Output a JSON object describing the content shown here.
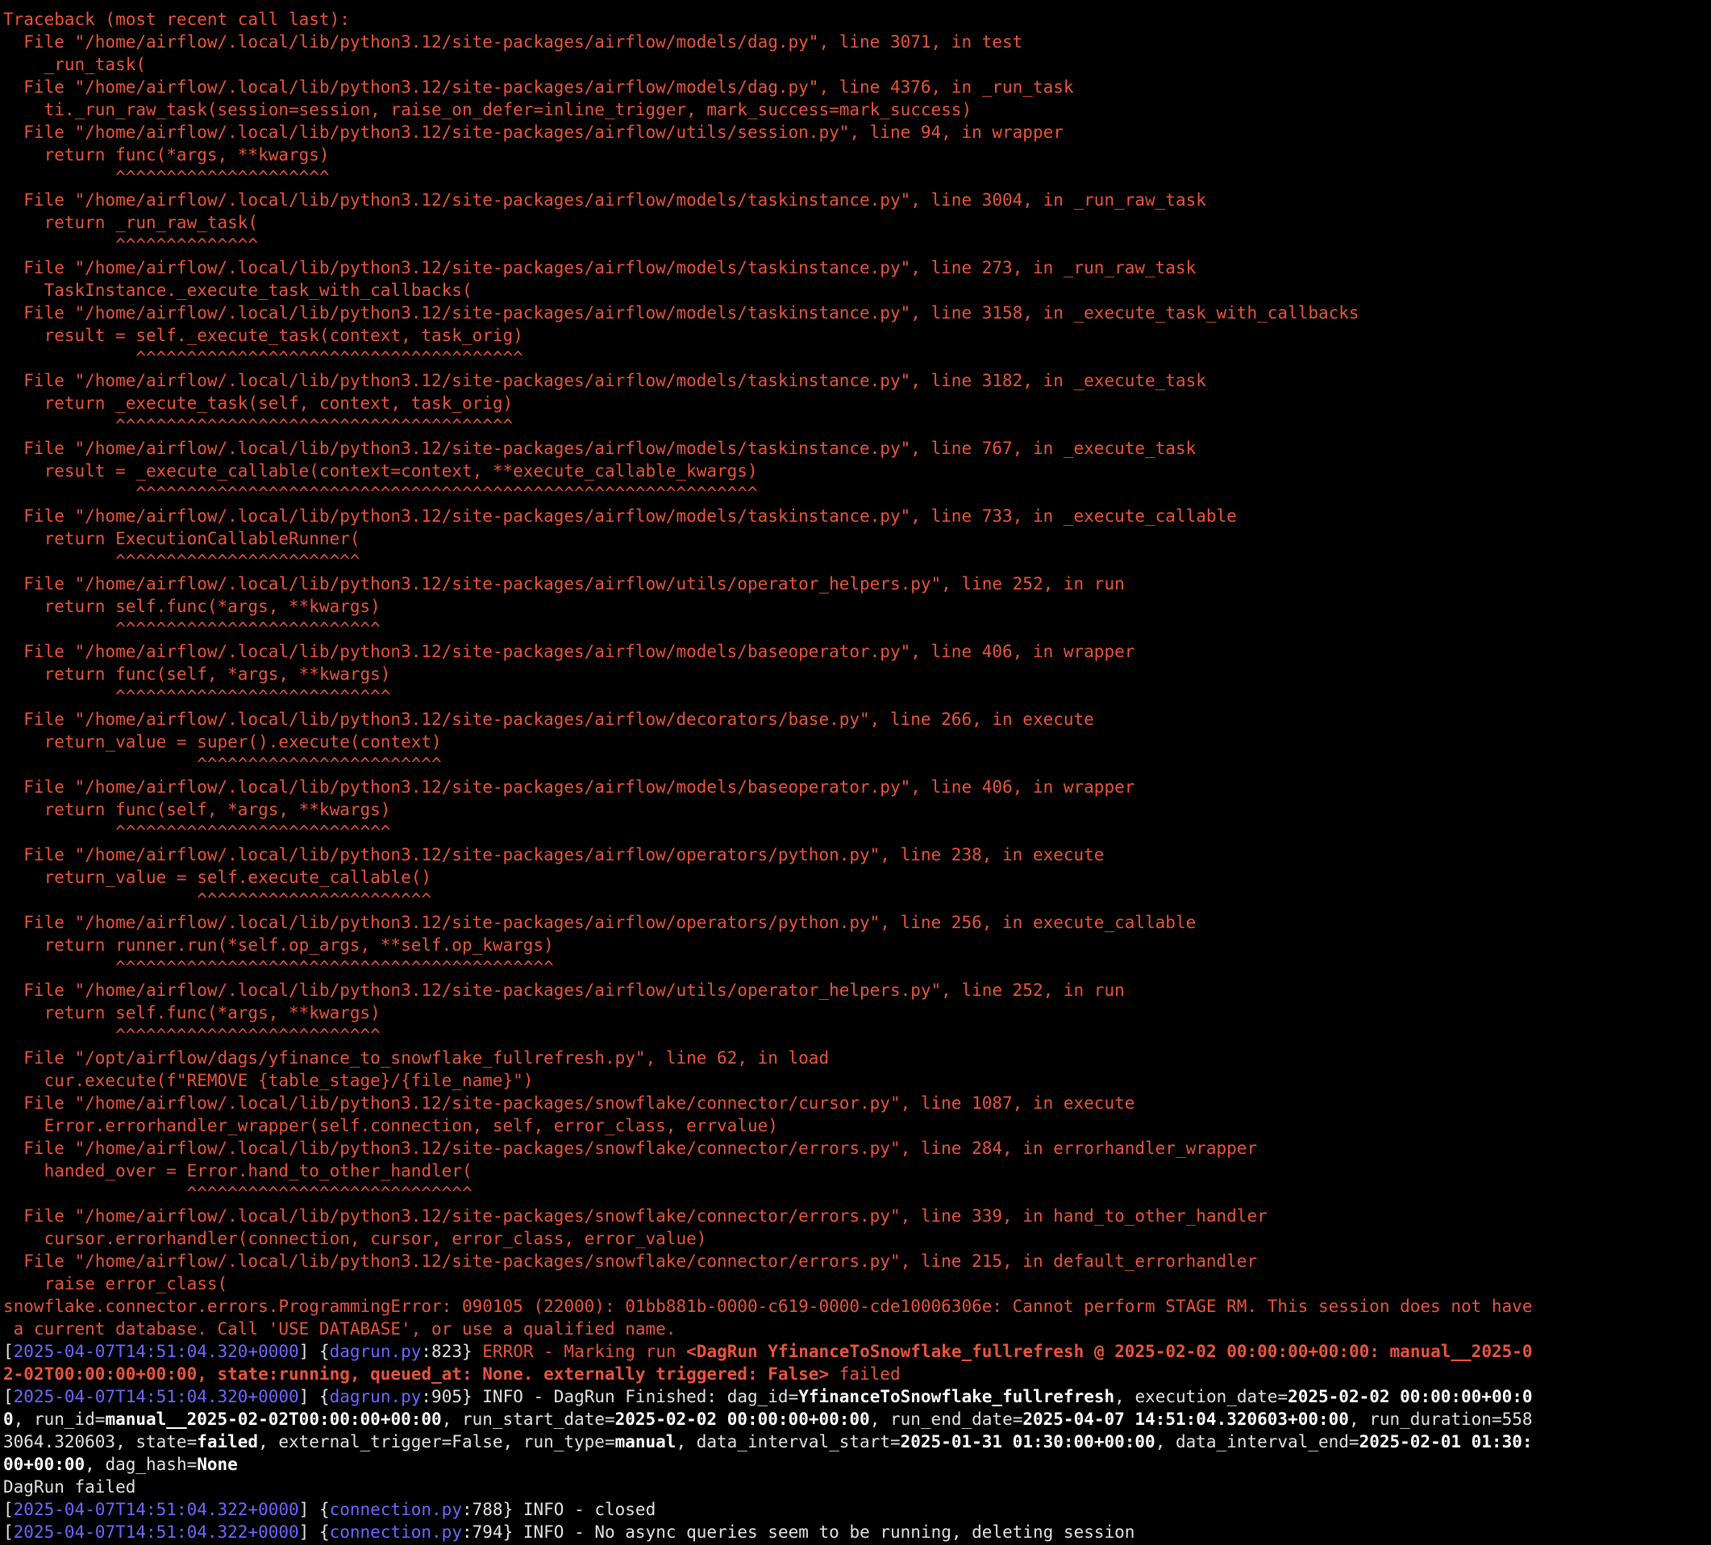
{
  "traceback": [
    "Traceback (most recent call last):",
    "  File \"/home/airflow/.local/lib/python3.12/site-packages/airflow/models/dag.py\", line 3071, in test",
    "    _run_task(",
    "  File \"/home/airflow/.local/lib/python3.12/site-packages/airflow/models/dag.py\", line 4376, in _run_task",
    "    ti._run_raw_task(session=session, raise_on_defer=inline_trigger, mark_success=mark_success)",
    "  File \"/home/airflow/.local/lib/python3.12/site-packages/airflow/utils/session.py\", line 94, in wrapper",
    "    return func(*args, **kwargs)",
    "           ^^^^^^^^^^^^^^^^^^^^^",
    "  File \"/home/airflow/.local/lib/python3.12/site-packages/airflow/models/taskinstance.py\", line 3004, in _run_raw_task",
    "    return _run_raw_task(",
    "           ^^^^^^^^^^^^^^",
    "  File \"/home/airflow/.local/lib/python3.12/site-packages/airflow/models/taskinstance.py\", line 273, in _run_raw_task",
    "    TaskInstance._execute_task_with_callbacks(",
    "  File \"/home/airflow/.local/lib/python3.12/site-packages/airflow/models/taskinstance.py\", line 3158, in _execute_task_with_callbacks",
    "    result = self._execute_task(context, task_orig)",
    "             ^^^^^^^^^^^^^^^^^^^^^^^^^^^^^^^^^^^^^^",
    "  File \"/home/airflow/.local/lib/python3.12/site-packages/airflow/models/taskinstance.py\", line 3182, in _execute_task",
    "    return _execute_task(self, context, task_orig)",
    "           ^^^^^^^^^^^^^^^^^^^^^^^^^^^^^^^^^^^^^^^",
    "  File \"/home/airflow/.local/lib/python3.12/site-packages/airflow/models/taskinstance.py\", line 767, in _execute_task",
    "    result = _execute_callable(context=context, **execute_callable_kwargs)",
    "             ^^^^^^^^^^^^^^^^^^^^^^^^^^^^^^^^^^^^^^^^^^^^^^^^^^^^^^^^^^^^^",
    "  File \"/home/airflow/.local/lib/python3.12/site-packages/airflow/models/taskinstance.py\", line 733, in _execute_callable",
    "    return ExecutionCallableRunner(",
    "           ^^^^^^^^^^^^^^^^^^^^^^^^",
    "  File \"/home/airflow/.local/lib/python3.12/site-packages/airflow/utils/operator_helpers.py\", line 252, in run",
    "    return self.func(*args, **kwargs)",
    "           ^^^^^^^^^^^^^^^^^^^^^^^^^^",
    "  File \"/home/airflow/.local/lib/python3.12/site-packages/airflow/models/baseoperator.py\", line 406, in wrapper",
    "    return func(self, *args, **kwargs)",
    "           ^^^^^^^^^^^^^^^^^^^^^^^^^^^",
    "  File \"/home/airflow/.local/lib/python3.12/site-packages/airflow/decorators/base.py\", line 266, in execute",
    "    return_value = super().execute(context)",
    "                   ^^^^^^^^^^^^^^^^^^^^^^^^",
    "  File \"/home/airflow/.local/lib/python3.12/site-packages/airflow/models/baseoperator.py\", line 406, in wrapper",
    "    return func(self, *args, **kwargs)",
    "           ^^^^^^^^^^^^^^^^^^^^^^^^^^^",
    "  File \"/home/airflow/.local/lib/python3.12/site-packages/airflow/operators/python.py\", line 238, in execute",
    "    return_value = self.execute_callable()",
    "                   ^^^^^^^^^^^^^^^^^^^^^^^",
    "  File \"/home/airflow/.local/lib/python3.12/site-packages/airflow/operators/python.py\", line 256, in execute_callable",
    "    return runner.run(*self.op_args, **self.op_kwargs)",
    "           ^^^^^^^^^^^^^^^^^^^^^^^^^^^^^^^^^^^^^^^^^^^",
    "  File \"/home/airflow/.local/lib/python3.12/site-packages/airflow/utils/operator_helpers.py\", line 252, in run",
    "    return self.func(*args, **kwargs)",
    "           ^^^^^^^^^^^^^^^^^^^^^^^^^^",
    "  File \"/opt/airflow/dags/yfinance_to_snowflake_fullrefresh.py\", line 62, in load",
    "    cur.execute(f\"REMOVE {table_stage}/{file_name}\")",
    "  File \"/home/airflow/.local/lib/python3.12/site-packages/snowflake/connector/cursor.py\", line 1087, in execute",
    "    Error.errorhandler_wrapper(self.connection, self, error_class, errvalue)",
    "  File \"/home/airflow/.local/lib/python3.12/site-packages/snowflake/connector/errors.py\", line 284, in errorhandler_wrapper",
    "    handed_over = Error.hand_to_other_handler(",
    "                  ^^^^^^^^^^^^^^^^^^^^^^^^^^^^",
    "  File \"/home/airflow/.local/lib/python3.12/site-packages/snowflake/connector/errors.py\", line 339, in hand_to_other_handler",
    "    cursor.errorhandler(connection, cursor, error_class, error_value)",
    "  File \"/home/airflow/.local/lib/python3.12/site-packages/snowflake/connector/errors.py\", line 215, in default_errorhandler",
    "    raise error_class(",
    "snowflake.connector.errors.ProgrammingError: 090105 (22000): 01bb881b-0000-c619-0000-cde10006306e: Cannot perform STAGE RM. This session does not have",
    " a current database. Call 'USE DATABASE', or use a qualified name."
  ],
  "log": {
    "error1": {
      "ts": "2025-04-07T14:51:04.320+0000",
      "src": "dagrun.py",
      "lineno": ":823",
      "prefix": " ERROR - Marking run ",
      "bold1": "<DagRun YfinanceToSnowflake_fullrefresh @ 2025-02-02 00:00:00+00:00: manual__2025-0",
      "bold2": "2-02T00:00:00+00:00, state:running, queued_at: None. externally triggered: False>",
      "suffix": " failed"
    },
    "info1": {
      "ts": "2025-04-07T14:51:04.320+0000",
      "src": "dagrun.py",
      "lineno": ":905",
      "l1_a": " INFO - DagRun Finished: dag_id=",
      "l1_b": "YfinanceToSnowflake_fullrefresh",
      "l1_c": ", execution_date=",
      "l1_d": "2025-02-02 00:00:00+00:0",
      "l2_a": "0",
      "l2_b": ", run_id=",
      "l2_c": "manual__2025-02-02T00:00:00+00:00",
      "l2_d": ", run_start_date=",
      "l2_e": "2025-02-02 00:00:00+00:00",
      "l2_f": ", run_end_date=",
      "l2_g": "2025-04-07 14:51:04.320603+00:00",
      "l2_h": ", run_duration=558",
      "l3_a": "3064.320603, state=",
      "l3_b": "failed",
      "l3_c": ", external_trigger=False, run_type=",
      "l3_d": "manual",
      "l3_e": ", data_interval_start=",
      "l3_f": "2025-01-31 01:30:00+00:00",
      "l3_g": ", data_interval_end=",
      "l3_h": "2025-02-01 01:30:",
      "l4_a": "00+00:00",
      "l4_b": ", dag_hash=",
      "l4_c": "None"
    },
    "dagrun_failed": "DagRun failed",
    "info2": {
      "ts": "2025-04-07T14:51:04.322+0000",
      "src": "connection.py",
      "lineno": ":788",
      "msg": " INFO - closed"
    },
    "info3": {
      "ts": "2025-04-07T14:51:04.322+0000",
      "src": "connection.py",
      "lineno": ":794",
      "msg": " INFO - No async queries seem to be running, deleting session"
    }
  },
  "colors": {
    "background": "#000000",
    "error_text": "#e8553c",
    "timestamp": "#7066ff",
    "plain_text": "#e3e3e3"
  }
}
